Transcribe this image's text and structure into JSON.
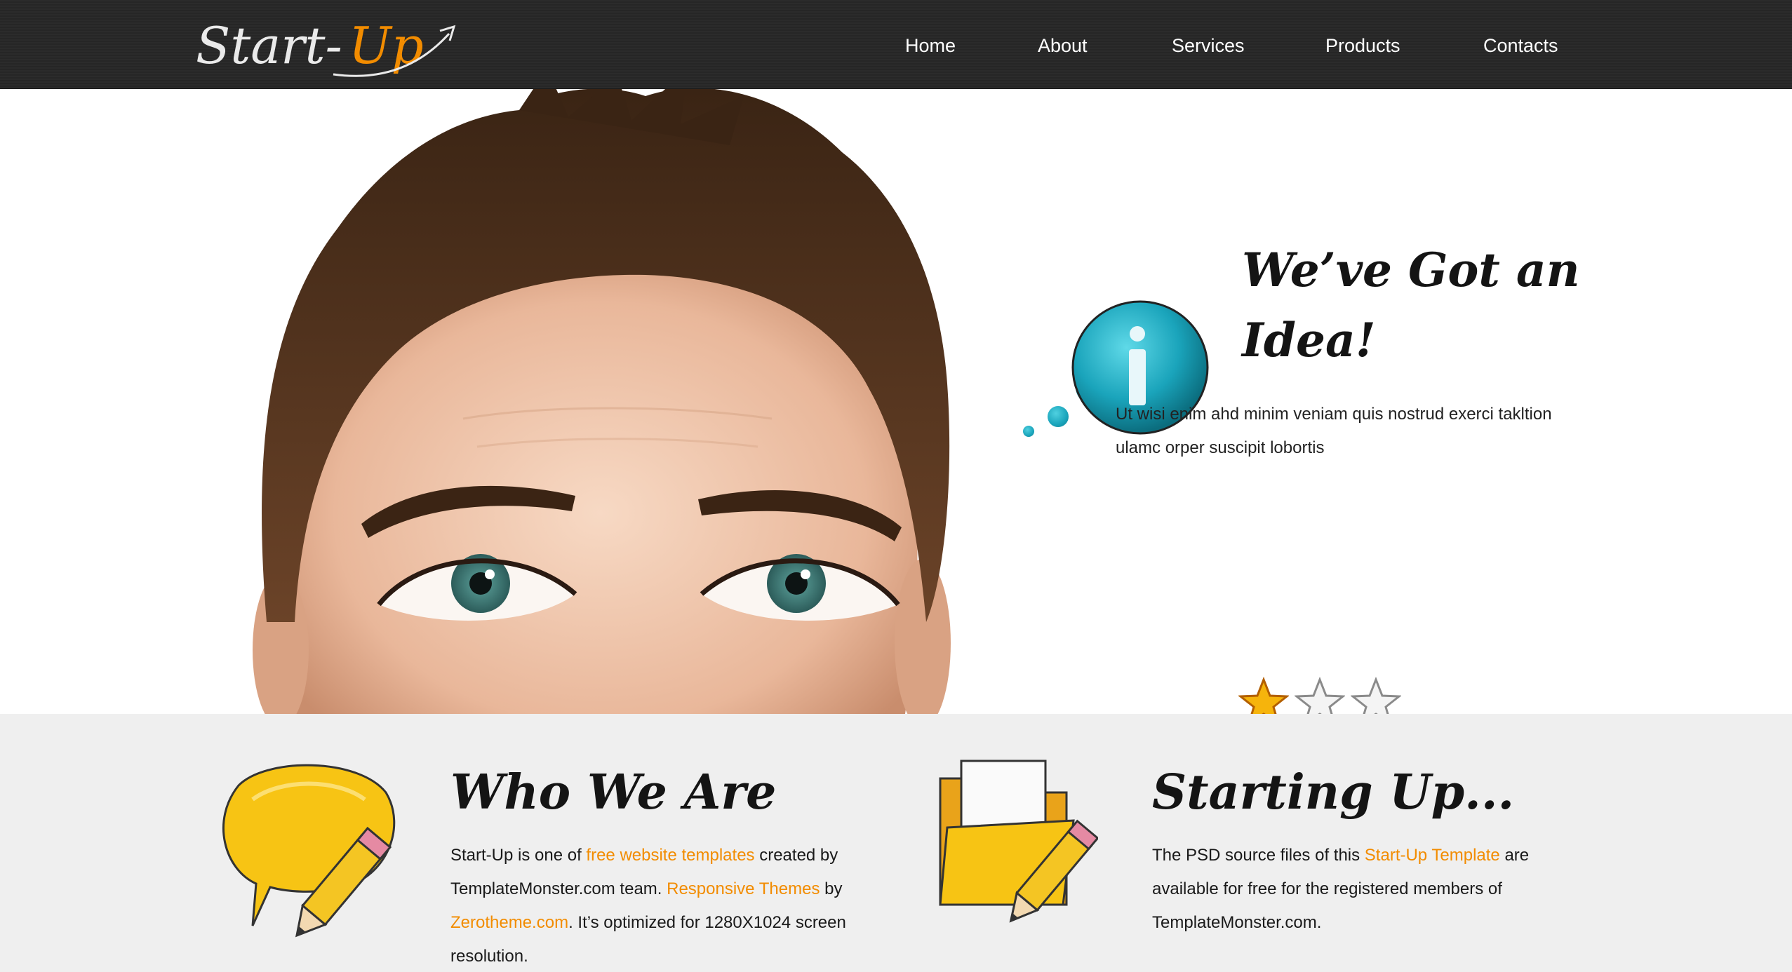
{
  "header": {
    "logo": {
      "start": "Start-",
      "up": "Up"
    },
    "nav": [
      {
        "label": "Home"
      },
      {
        "label": "About"
      },
      {
        "label": "Services"
      },
      {
        "label": "Products"
      },
      {
        "label": "Contacts"
      }
    ]
  },
  "hero": {
    "title_line1": "We’ve Got an",
    "title_line2": "Idea!",
    "text": "Ut wisi enim ahd minim veniam quis nostrud exerci takltion ulamc orper suscipit lobortis",
    "rating": {
      "filled": 1,
      "total": 3
    }
  },
  "who_we_are": {
    "title": "Who We Are",
    "p1": "Start-Up is one of ",
    "link1": "free website templates",
    "p2": " created by TemplateMonster.com team. ",
    "link2": "Responsive Themes",
    "p3": " by ",
    "link3": "Zerotheme.com",
    "p4": ". It’s optimized for 1280X1024 screen resolution."
  },
  "starting_up": {
    "title": "Starting Up...",
    "p1": "The PSD source files of this ",
    "link1": "Start-Up Template",
    "p2": " are available for free for the registered members of TemplateMonster.com."
  },
  "colors": {
    "accent": "#f28c00",
    "header_bg": "#2b2b2b",
    "lower_bg": "#efefef",
    "info_blue": "#1aa4bb"
  },
  "icons": [
    "info-icon",
    "speech-bubble-pencil-icon",
    "folder-pencil-icon",
    "star-icon"
  ]
}
